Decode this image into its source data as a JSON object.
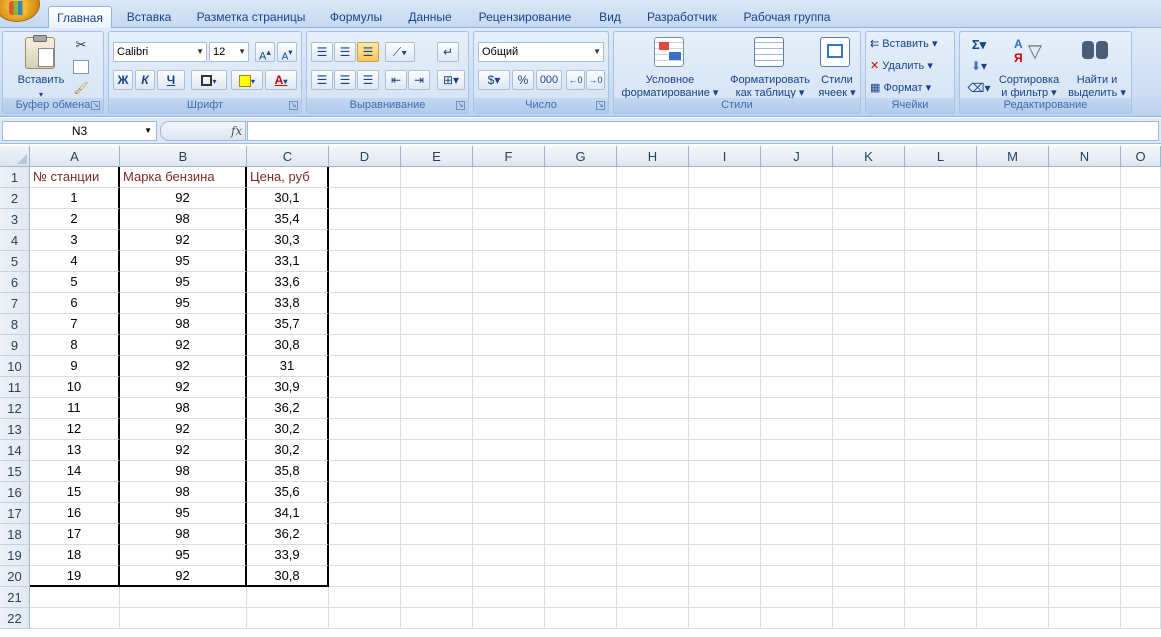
{
  "tabs": [
    {
      "label": "Главная",
      "active": true
    },
    {
      "label": "Вставка"
    },
    {
      "label": "Разметка страницы"
    },
    {
      "label": "Формулы"
    },
    {
      "label": "Данные"
    },
    {
      "label": "Рецензирование"
    },
    {
      "label": "Вид"
    },
    {
      "label": "Разработчик"
    },
    {
      "label": "Рабочая группа"
    }
  ],
  "ribbon": {
    "clipboard": {
      "label": "Буфер обмена",
      "paste": "Вставить"
    },
    "font": {
      "label": "Шрифт",
      "name": "Calibri",
      "size": "12",
      "bold": "Ж",
      "italic": "К",
      "underline": "Ч"
    },
    "alignment": {
      "label": "Выравнивание"
    },
    "number": {
      "label": "Число",
      "format": "Общий",
      "percent": "%",
      "thousands": "000"
    },
    "styles": {
      "label": "Стили",
      "conditional_1": "Условное",
      "conditional_2": "форматирование",
      "table_1": "Форматировать",
      "table_2": "как таблицу",
      "cell_1": "Стили",
      "cell_2": "ячеек"
    },
    "cells": {
      "label": "Ячейки",
      "insert": "Вставить",
      "delete": "Удалить",
      "format": "Формат"
    },
    "editing": {
      "label": "Редактирование",
      "sigma": "Σ",
      "sort_1": "Сортировка",
      "sort_2": "и фильтр",
      "find_1": "Найти и",
      "find_2": "выделить"
    }
  },
  "formula_bar": {
    "name_box": "N3",
    "fx": "fx",
    "formula": ""
  },
  "columns": [
    "A",
    "B",
    "C",
    "D",
    "E",
    "F",
    "G",
    "H",
    "I",
    "J",
    "K",
    "L",
    "M",
    "N",
    "O"
  ],
  "rows": [
    "1",
    "2",
    "3",
    "4",
    "5",
    "6",
    "7",
    "8",
    "9",
    "10",
    "11",
    "12",
    "13",
    "14",
    "15",
    "16",
    "17",
    "18",
    "19",
    "20",
    "21",
    "22"
  ],
  "table": {
    "headers": [
      "№ станции",
      "Марка бензина",
      "Цена, руб"
    ],
    "rows": [
      [
        "1",
        "92",
        "30,1"
      ],
      [
        "2",
        "98",
        "35,4"
      ],
      [
        "3",
        "92",
        "30,3"
      ],
      [
        "4",
        "95",
        "33,1"
      ],
      [
        "5",
        "95",
        "33,6"
      ],
      [
        "6",
        "95",
        "33,8"
      ],
      [
        "7",
        "98",
        "35,7"
      ],
      [
        "8",
        "92",
        "30,8"
      ],
      [
        "9",
        "92",
        "31"
      ],
      [
        "10",
        "92",
        "30,9"
      ],
      [
        "11",
        "98",
        "36,2"
      ],
      [
        "12",
        "92",
        "30,2"
      ],
      [
        "13",
        "92",
        "30,2"
      ],
      [
        "14",
        "98",
        "35,8"
      ],
      [
        "15",
        "98",
        "35,6"
      ],
      [
        "16",
        "95",
        "34,1"
      ],
      [
        "17",
        "98",
        "36,2"
      ],
      [
        "18",
        "95",
        "33,9"
      ],
      [
        "19",
        "92",
        "30,8"
      ]
    ]
  },
  "colors": {
    "header_text": "#7b2d20",
    "ribbon_text": "#15428b"
  }
}
